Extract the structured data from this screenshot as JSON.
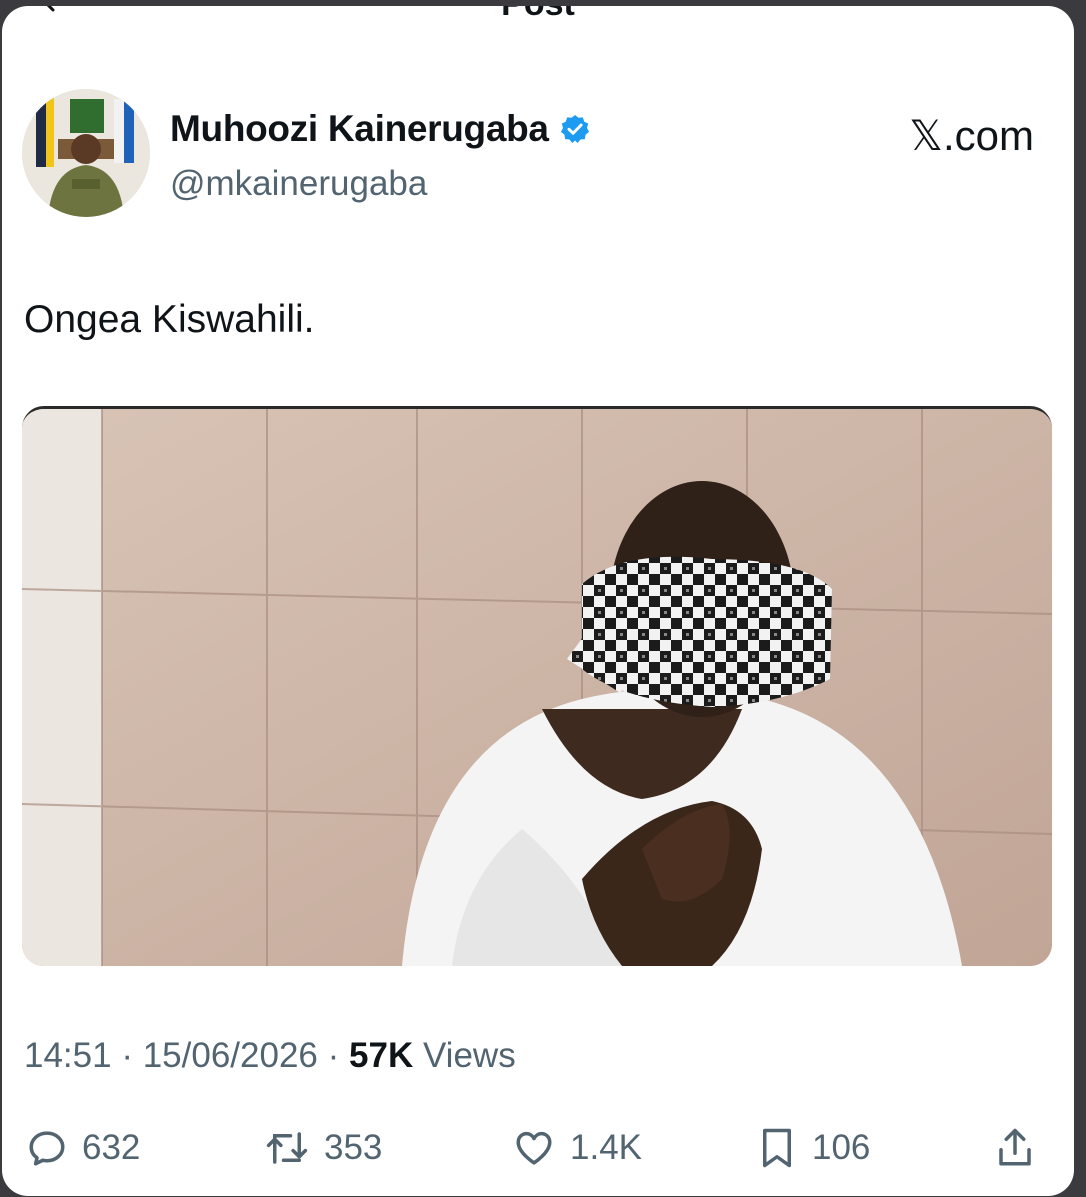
{
  "header": {
    "title": "Post"
  },
  "author": {
    "display_name": "Muhoozi Kainerugaba",
    "handle": "@mkainerugaba",
    "verified": true,
    "verified_color": "#1d9bf0"
  },
  "brand": {
    "x_glyph": "𝕏",
    "domain": ".com"
  },
  "post": {
    "text": "Ongea Kiswahili.",
    "time": "14:51",
    "separator": "·",
    "date": "15/06/2026",
    "views_count": "57K",
    "views_label": "Views"
  },
  "actions": {
    "replies": "632",
    "reposts": "353",
    "likes": "1.4K",
    "bookmarks": "106"
  },
  "icons": {
    "back": "back-arrow-icon",
    "verified": "verified-badge-icon",
    "reply": "reply-icon",
    "repost": "repost-icon",
    "like": "heart-icon",
    "bookmark": "bookmark-icon",
    "share": "share-icon"
  },
  "colors": {
    "text_primary": "#0f1419",
    "text_secondary": "#536471",
    "accent": "#1d9bf0",
    "background": "#ffffff"
  }
}
